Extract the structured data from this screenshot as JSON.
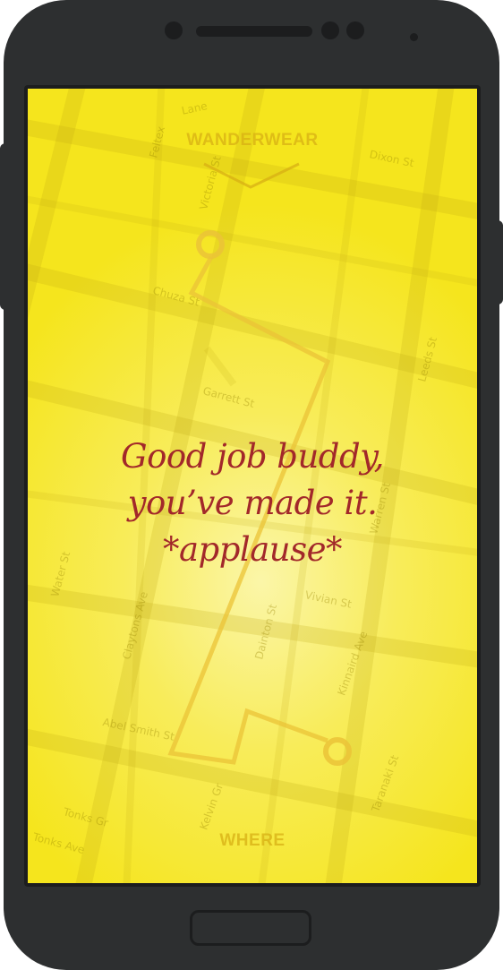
{
  "app": {
    "brand": "WANDERWEAR",
    "message_lines": [
      "Good job buddy,",
      "you’ve made it.",
      "*applause*"
    ],
    "bottom_label": "WHERE"
  },
  "map": {
    "streets": [
      "Lane",
      "Dixon St",
      "Feltex",
      "Victoria St",
      "Chuza St",
      "Garrett St",
      "Leeds St",
      "Warren St",
      "Vivian St",
      "Water St",
      "Claytons Ave",
      "Dainton St",
      "Kinnaird Ave",
      "Abel Smith St",
      "Tonks Gr",
      "Tonks Ave",
      "Kelvin Gr",
      "Taranaki St"
    ]
  },
  "colors": {
    "screen_background": "#f5e51d",
    "message_text": "#a2282a",
    "route_line": "#f0d040",
    "phone_body": "#2d2f30"
  },
  "icons": {
    "route_start": "route-start-marker-icon",
    "route_end": "route-end-marker-icon",
    "brand_chevron": "chevron-down-icon"
  }
}
